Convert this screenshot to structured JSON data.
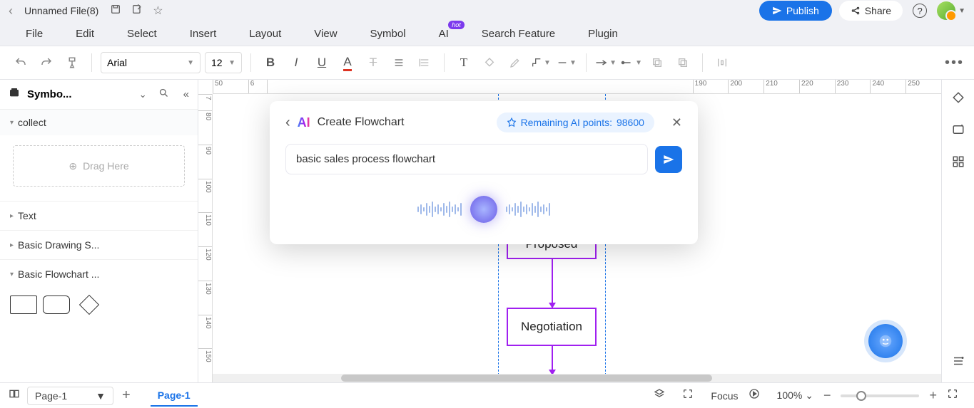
{
  "titlebar": {
    "filename": "Unnamed File(8)",
    "publish_label": "Publish",
    "share_label": "Share"
  },
  "menubar": {
    "items": [
      "File",
      "Edit",
      "Select",
      "Insert",
      "Layout",
      "View",
      "Symbol",
      "AI",
      "Search Feature",
      "Plugin"
    ],
    "hot_badge": "hot"
  },
  "toolbar": {
    "font": "Arial",
    "font_size": "12"
  },
  "leftpanel": {
    "title": "Symbo...",
    "sections": {
      "collect": "collect",
      "drag_here": "Drag Here",
      "text": "Text",
      "basic_drawing": "Basic Drawing S...",
      "basic_flowchart": "Basic Flowchart ..."
    }
  },
  "ruler_h": [
    "50",
    "",
    "",
    "",
    "",
    "190",
    "200",
    "210",
    "220",
    "230",
    "240",
    "250"
  ],
  "ruler_h_start6": "6",
  "ruler_v": [
    "7",
    "80",
    "90",
    "100",
    "110",
    "120",
    "130",
    "140",
    "150"
  ],
  "ai": {
    "title": "Create Flowchart",
    "points_prefix": "Remaining AI points: ",
    "points": "98600",
    "input_value": "basic sales process flowchart"
  },
  "flow": {
    "node1": "Proposed",
    "node2": "Negotiation"
  },
  "statusbar": {
    "page_select": "Page-1",
    "tab_active": "Page-1",
    "focus": "Focus",
    "zoom": "100%"
  }
}
